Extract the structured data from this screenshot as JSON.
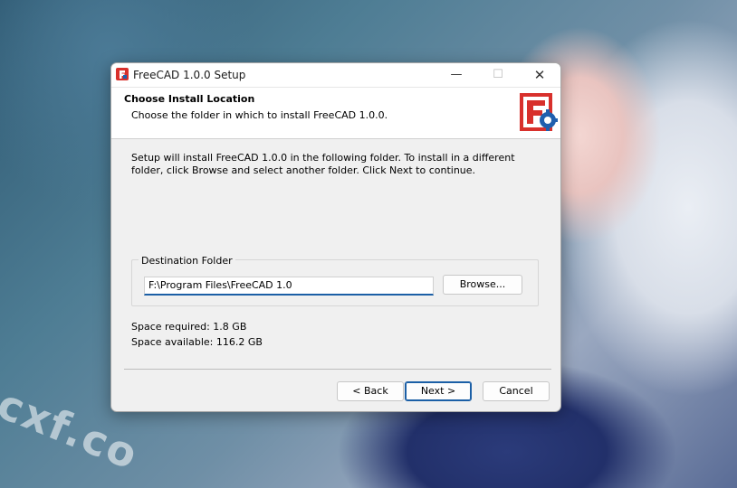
{
  "window": {
    "title": "FreeCAD 1.0.0 Setup",
    "controls": {
      "minimize": "—",
      "maximize": "☐",
      "close": "✕"
    }
  },
  "header": {
    "title": "Choose Install Location",
    "subtitle": "Choose the folder in which to install FreeCAD 1.0.0."
  },
  "body": {
    "description": "Setup will install FreeCAD 1.0.0 in the following folder. To install in a different folder, click Browse and select another folder. Click Next to continue."
  },
  "destination": {
    "group_label": "Destination Folder",
    "path": "F:\\Program Files\\FreeCAD 1.0",
    "browse_label": "Browse..."
  },
  "space": {
    "required": "Space required: 1.8 GB",
    "available": "Space available: 116.2 GB"
  },
  "footer": {
    "back_label": "< Back",
    "next_label": "Next >",
    "cancel_label": "Cancel"
  },
  "watermark": "cxf.co",
  "icons": {
    "app": "freecad-logo-icon"
  },
  "colors": {
    "accent": "#1b5fa6",
    "logo_red": "#d8302c",
    "logo_blue": "#1f5fae"
  }
}
